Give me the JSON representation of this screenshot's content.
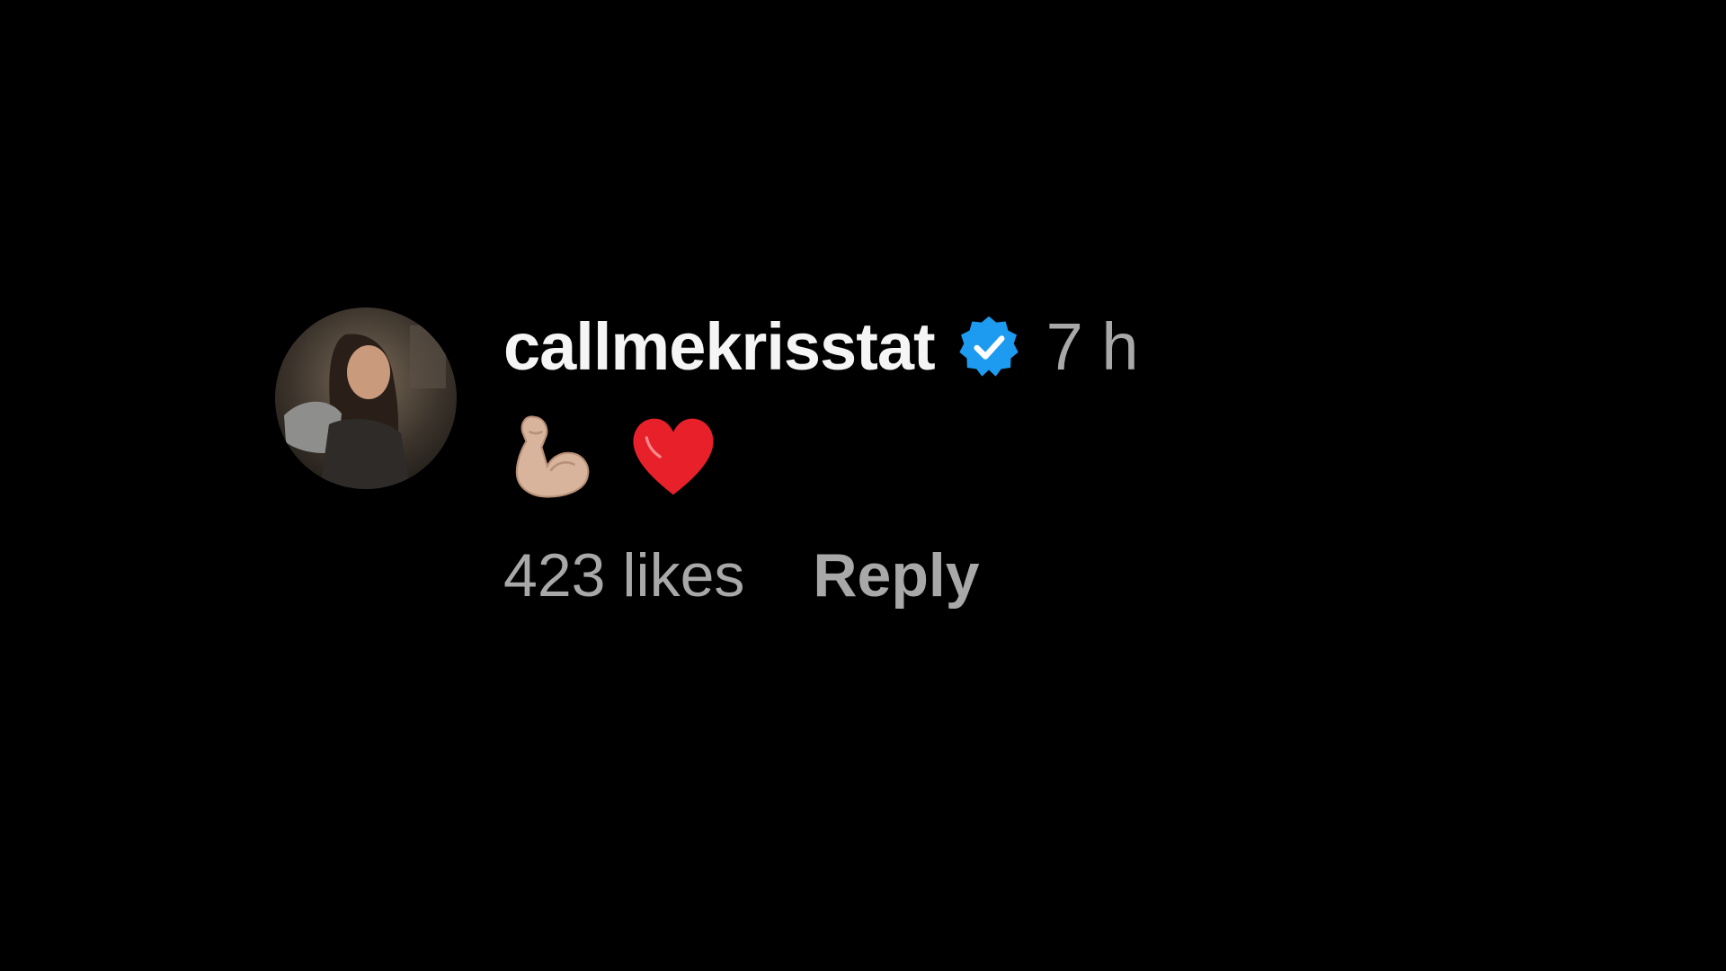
{
  "comment": {
    "username": "callmekrisstat",
    "verified": true,
    "timestamp": "7 h",
    "text_emojis": [
      "flexed-biceps-emoji",
      "red-heart-emoji"
    ],
    "likes_label": "423 likes",
    "reply_label": "Reply"
  },
  "colors": {
    "background": "#000000",
    "username": "#f5f5f5",
    "meta": "#a8a8a8",
    "verified_badge": "#1d9bf0",
    "heart": "#e8202a"
  }
}
